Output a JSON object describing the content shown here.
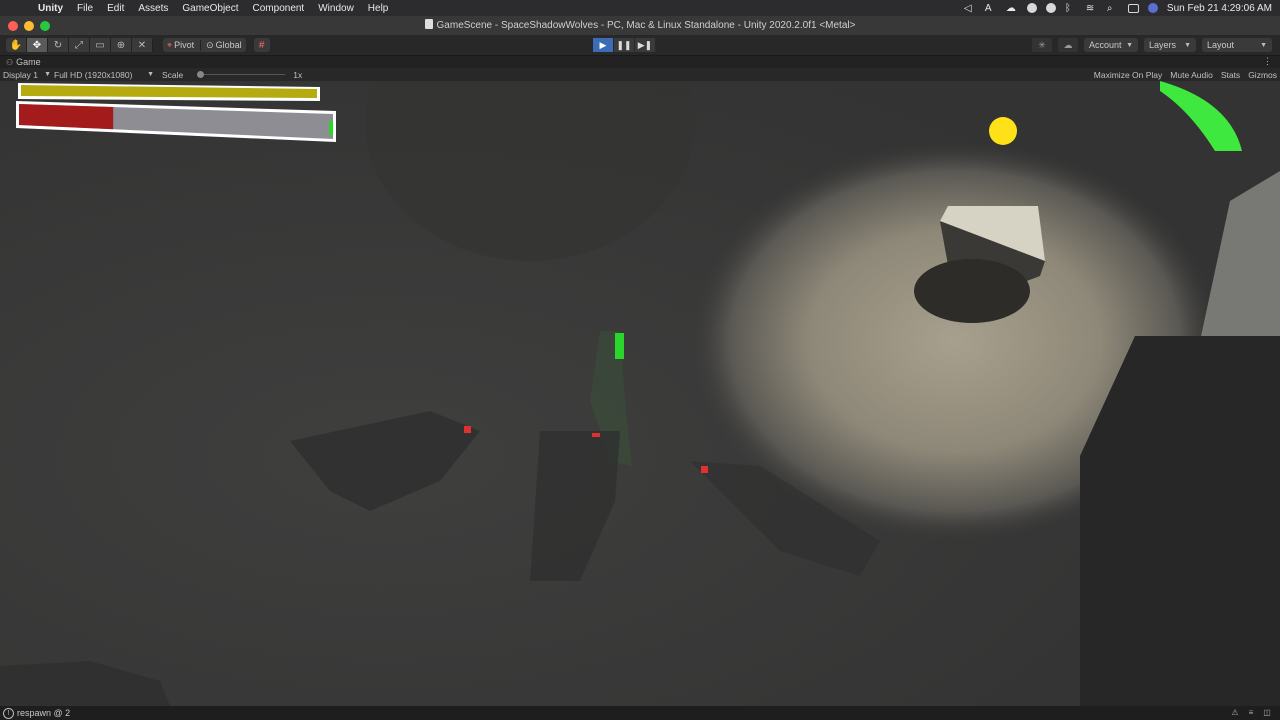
{
  "menubar": {
    "apple_icon": "apple-icon",
    "app_name": "Unity",
    "items": [
      "File",
      "Edit",
      "Assets",
      "GameObject",
      "Component",
      "Window",
      "Help"
    ],
    "clock": "Sun Feb 21  4:29:06 AM",
    "status_icons": [
      "unity-collab-icon",
      "font-icon",
      "cloud-icon",
      "shield-check-icon",
      "record-icon",
      "bluetooth-icon",
      "wifi-icon",
      "search-icon",
      "control-center-icon",
      "user-avatar-icon"
    ]
  },
  "window": {
    "title": "GameScene - SpaceShadowWolves - PC, Mac & Linux Standalone - Unity 2020.2.0f1 <Metal>"
  },
  "toolbar": {
    "tools": [
      "hand-tool-icon",
      "move-tool-icon",
      "rotate-tool-icon",
      "scale-tool-icon",
      "rect-tool-icon",
      "transform-tool-icon",
      "custom-tool-icon"
    ],
    "active_tool_index": 1,
    "pivot_label": "Pivot",
    "global_label": "Global",
    "account_label": "Account",
    "layers_label": "Layers",
    "layout_label": "Layout"
  },
  "game_panel": {
    "tab_label": "Game",
    "display_label": "Display 1",
    "resolution_label": "Full HD (1920x1080)",
    "scale_label": "Scale",
    "scale_value": "1x",
    "maximize_label": "Maximize On Play",
    "mute_label": "Mute Audio",
    "stats_label": "Stats",
    "gizmos_label": "Gizmos"
  },
  "hud": {
    "stamina_fraction": 1.0,
    "health_fraction": 0.3,
    "stamina_color": "#b5ab11",
    "health_color": "#a41b1b"
  },
  "statusbar": {
    "message": "respawn @ 2"
  }
}
